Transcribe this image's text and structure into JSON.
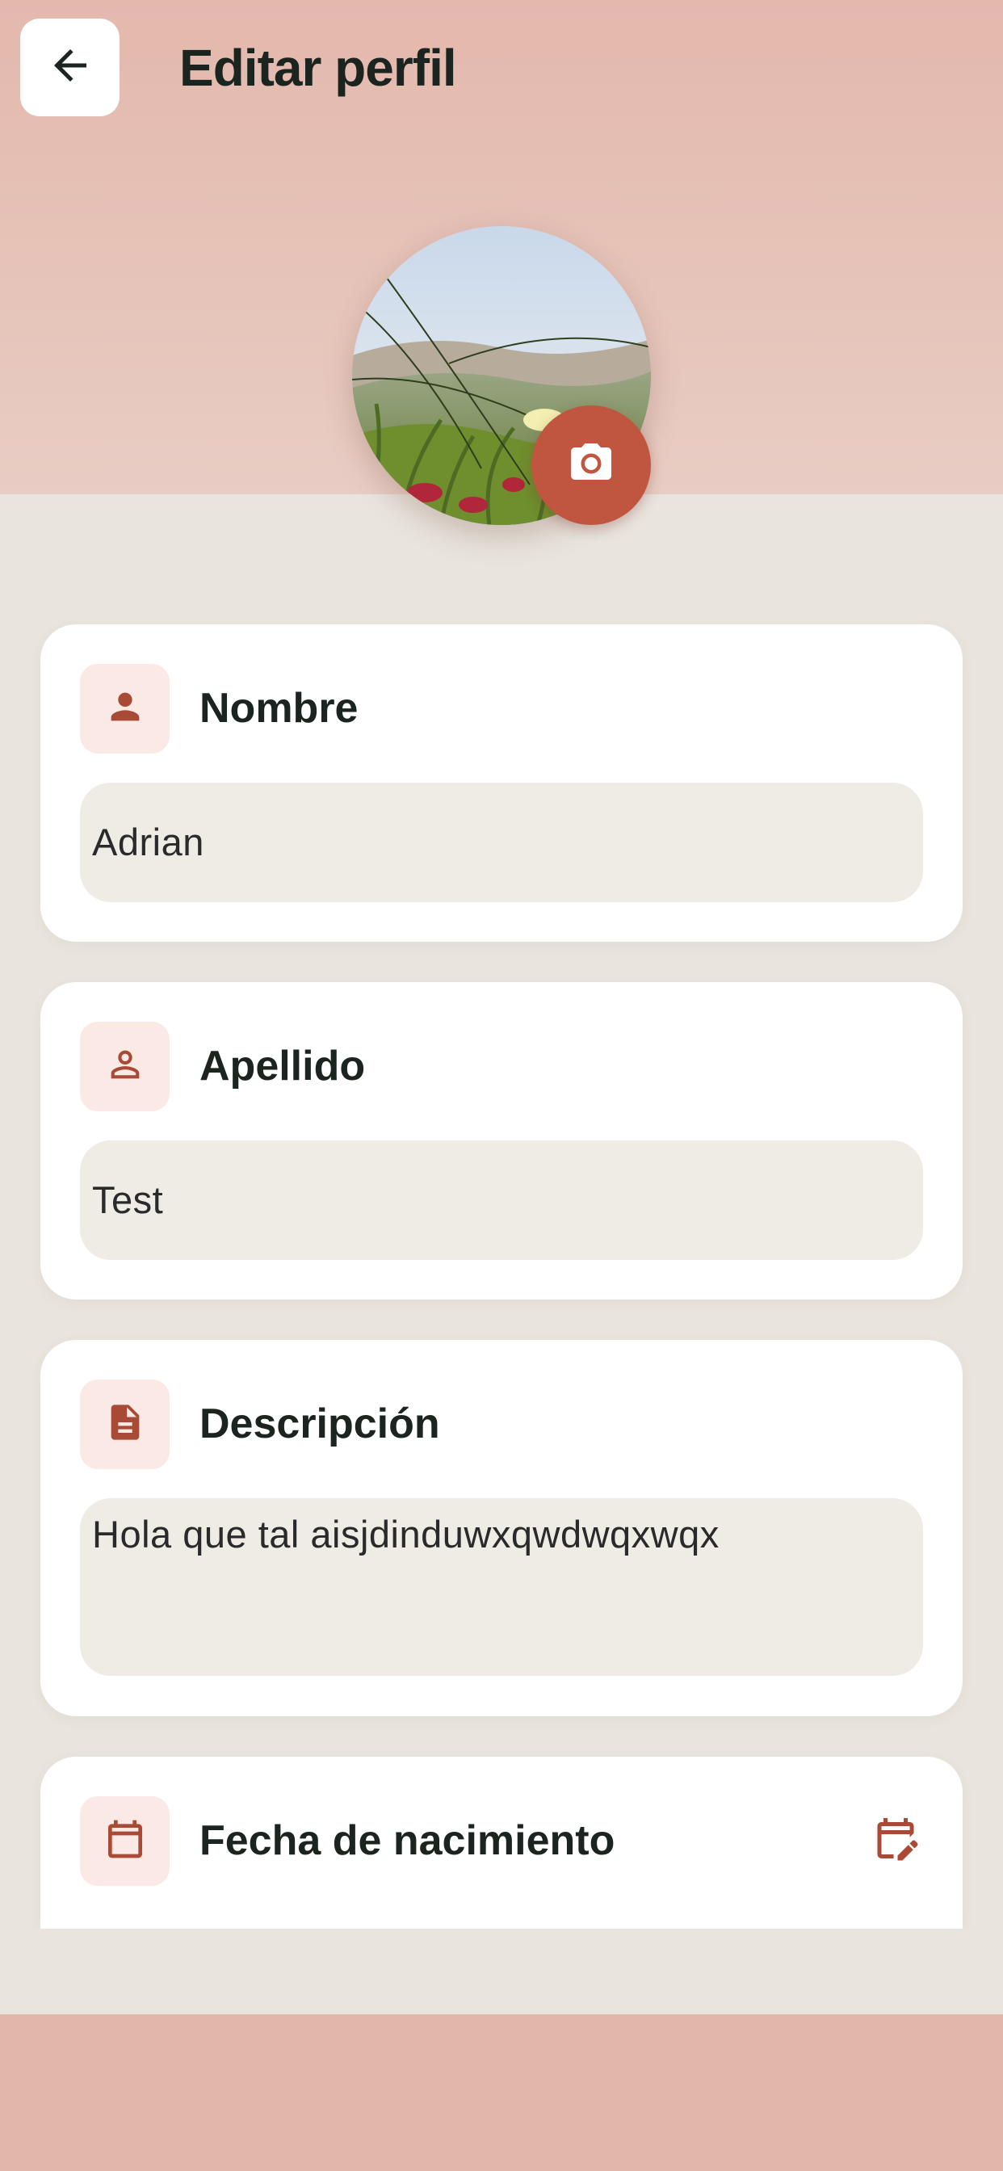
{
  "header": {
    "title": "Editar perfil",
    "back_icon": "arrow-left-icon"
  },
  "profile": {
    "photo_icon": "camera-icon"
  },
  "fields": {
    "nombre": {
      "label": "Nombre",
      "value": "Adrian",
      "icon": "person-filled-icon"
    },
    "apellido": {
      "label": "Apellido",
      "value": "Test",
      "icon": "person-outline-icon"
    },
    "descripcion": {
      "label": "Descripción",
      "value": "Hola que tal aisjdinduwxqwdwqxwqx",
      "icon": "document-icon"
    },
    "fecha": {
      "label": "Fecha de nacimiento",
      "icon": "calendar-icon",
      "edit_icon": "calendar-edit-icon"
    }
  },
  "colors": {
    "accent": "#c0563f",
    "icon_tint": "#a84a35",
    "icon_bg": "#fbe9e6",
    "header_bg": "#e4b8ad",
    "page_bg": "#e9e4dd",
    "field_bg": "#efebe5"
  }
}
